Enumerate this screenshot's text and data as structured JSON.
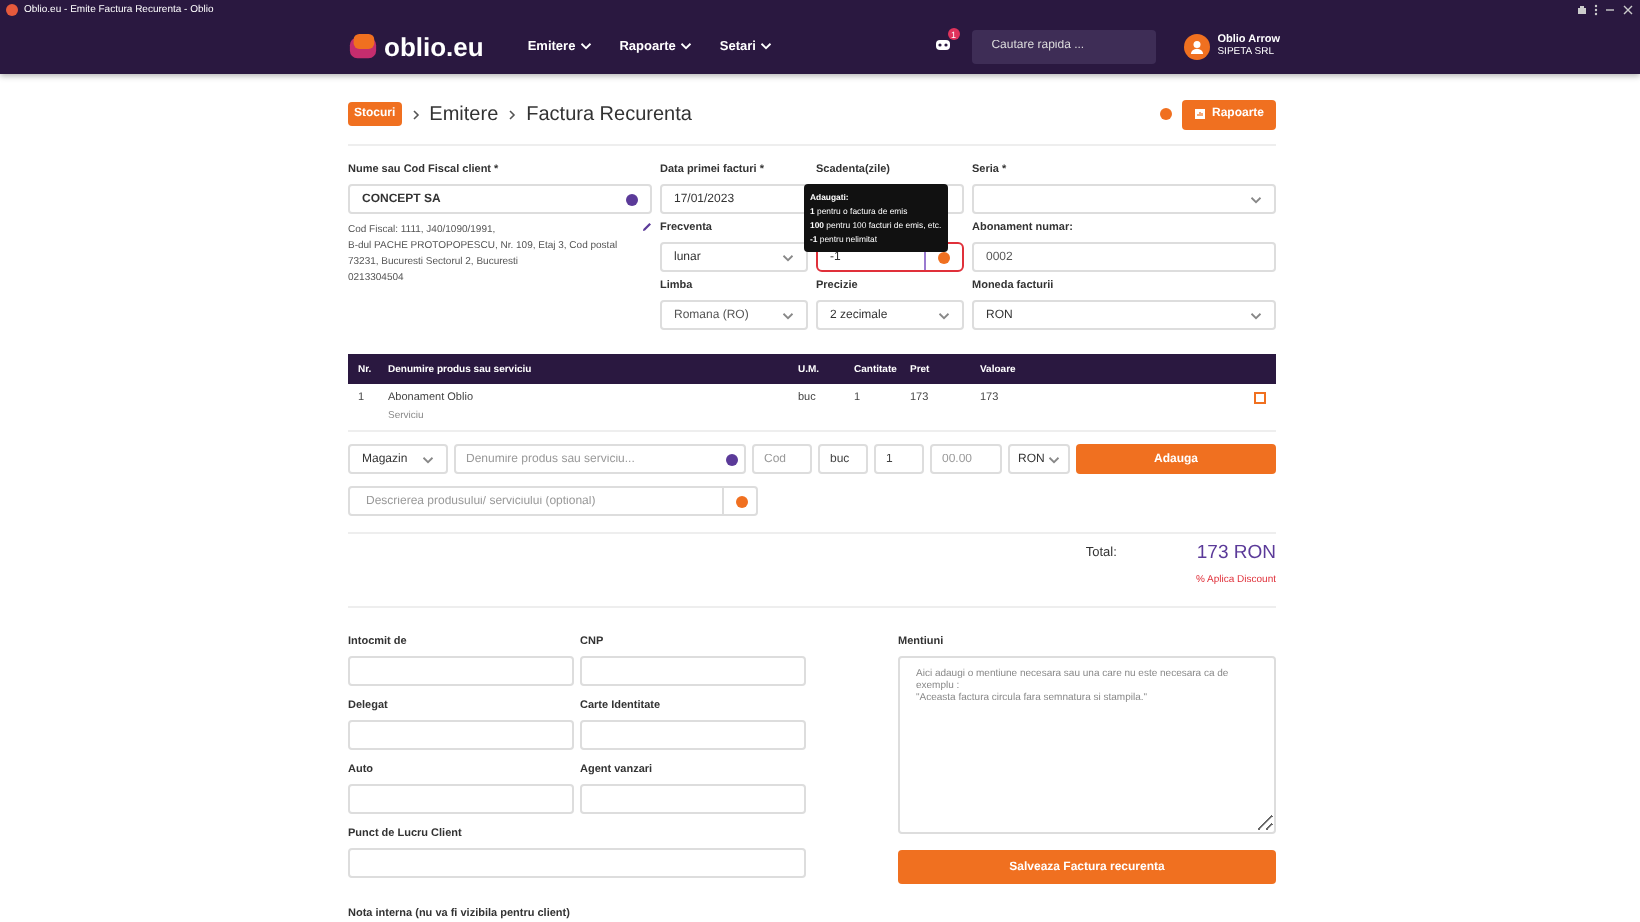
{
  "browser": {
    "tab_title": "Oblio.eu - Emite Factura Recurenta - Oblio"
  },
  "nav": {
    "logo": "oblio.eu",
    "menu": [
      "Emitere",
      "Rapoarte",
      "Setari"
    ],
    "notification_count": "1",
    "search_placeholder": "Cautare rapida ...",
    "user_name": "Oblio Arrow",
    "company": "SIPETA SRL"
  },
  "breadcrumb": {
    "badge": "Stocuri",
    "items": [
      "Emitere",
      "Factura Recurenta"
    ],
    "button": "Rapoarte"
  },
  "client": {
    "label": "Nume sau Cod Fiscal client *",
    "value": "CONCEPT SA",
    "details": [
      "Cod Fiscal: 1111, J40/1090/1991,",
      "B-dul PACHE PROTOPOPESCU, Nr. 109, Etaj 3, Cod postal",
      "73231, Bucuresti Sectorul 2, Bucuresti",
      "0213304504"
    ]
  },
  "fields": [
    {
      "label": "Data primei facturi *",
      "value": "17/01/2023",
      "kind": "input"
    },
    {
      "label": "Scadenta(zile)",
      "kind": "input"
    },
    {
      "label": "Seria *",
      "kind": "select"
    },
    {
      "label": "Frecventa",
      "value": "lunar",
      "kind": "select"
    },
    {
      "value": "-1",
      "kind": "info-input"
    },
    {
      "label": "Abonament numar:",
      "value": "0002",
      "kind": "input"
    },
    {
      "label": "Limba",
      "value": "Romana (RO)",
      "kind": "select"
    },
    {
      "label": "Precizie",
      "value": "2 zecimale",
      "kind": "select"
    },
    {
      "label": "Moneda facturii",
      "value": "RON",
      "kind": "select"
    }
  ],
  "tooltip": {
    "title": "Adaugati:",
    "lines": [
      "**1** pentru o factura de emis",
      "**100** pentru 100 facturi de emis, etc.",
      "**-1** pentru nelimitat"
    ]
  },
  "table": {
    "columns": [
      "Nr.",
      "Denumire produs sau serviciu",
      "U.M.",
      "Cantitate",
      "Pret",
      "Valoare"
    ],
    "rows": [
      {
        "nr": "1",
        "name": "Abonament Oblio",
        "type": "Serviciu",
        "um": "buc",
        "qty": "1",
        "price": "173",
        "value": "173"
      }
    ]
  },
  "add_row": {
    "source": "Magazin",
    "name_placeholder": "Denumire produs sau serviciu...",
    "code_placeholder": "Cod",
    "um": "buc",
    "qty": "1",
    "price_placeholder": "00.00",
    "currency": "RON",
    "button": "Adauga",
    "description_placeholder": "Descrierea produsului/ serviciului (optional)"
  },
  "totals": {
    "label": "Total:",
    "value": "173 RON",
    "discount": "% Aplica Discount"
  },
  "extra": [
    {
      "label": "Intocmit de"
    },
    {
      "label": "CNP"
    },
    {
      "label": "Delegat"
    },
    {
      "label": "Carte Identitate"
    },
    {
      "label": "Auto"
    },
    {
      "label": "Agent vanzari"
    }
  ],
  "work_point": {
    "label": "Punct de Lucru Client"
  },
  "notes": {
    "label": "Mentiuni",
    "placeholder": "Aici adaugi o mentiune necesara sau una care nu este necesara ca de exemplu :\n\"Aceasta factura circula fara semnatura si stampila.\""
  },
  "save_button": "Salveaza Factura recurenta",
  "internal_note": "Nota interna (nu va fi vizibila pentru client)"
}
